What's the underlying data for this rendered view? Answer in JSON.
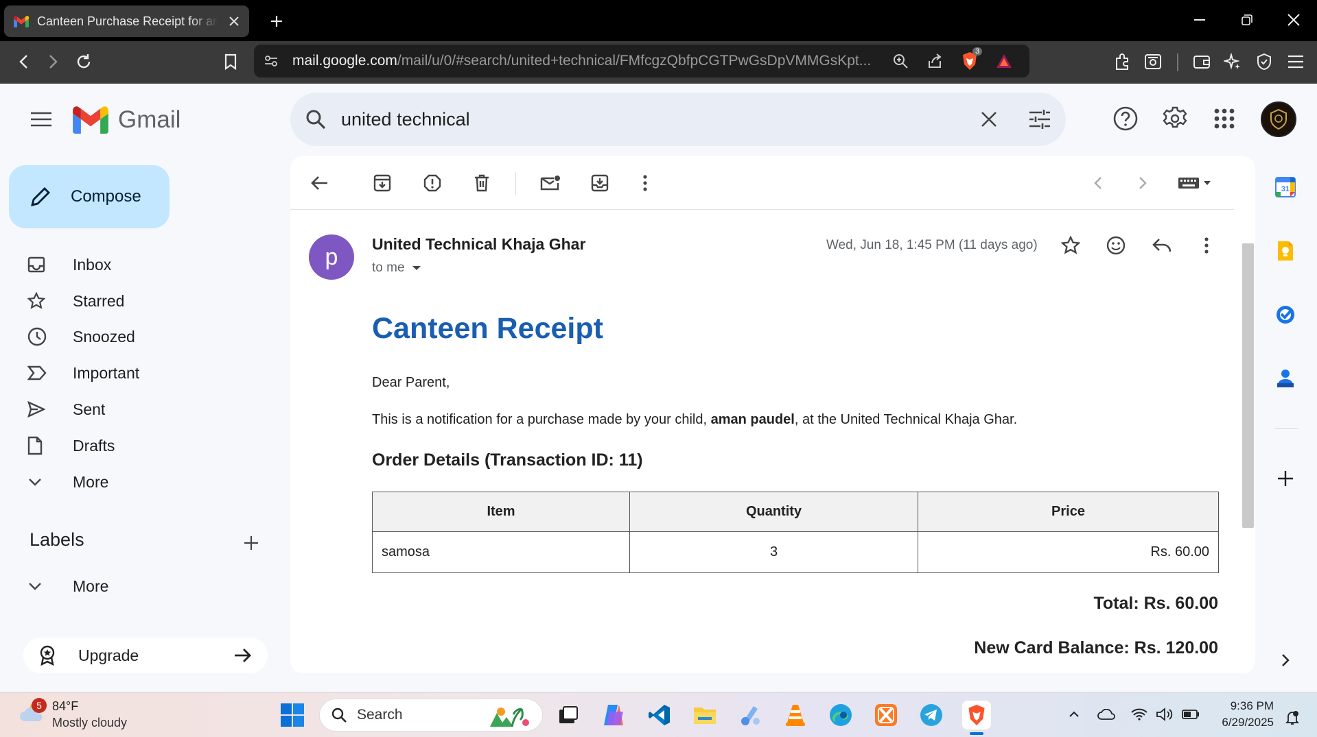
{
  "browser": {
    "tab_title": "Canteen Purchase Receipt for aman paudel",
    "url_host": "mail.google.com",
    "url_path": "/mail/u/0/#search/united+technical/FMfcgzQbfpCGTPwGsDpVMMGsKpt...",
    "brave_shield_count": "3"
  },
  "gmail": {
    "brand": "Gmail",
    "search_value": "united technical",
    "compose_label": "Compose",
    "nav": [
      {
        "label": "Inbox"
      },
      {
        "label": "Starred"
      },
      {
        "label": "Snoozed"
      },
      {
        "label": "Important"
      },
      {
        "label": "Sent"
      },
      {
        "label": "Drafts"
      },
      {
        "label": "More"
      }
    ],
    "labels_header": "Labels",
    "labels_more": "More",
    "upgrade_label": "Upgrade"
  },
  "message": {
    "sender_initial": "p",
    "sender_name": "United Technical Khaja Ghar",
    "to_line": "to me",
    "date": "Wed, Jun 18, 1:45 PM (11 days ago)",
    "title": "Canteen Receipt",
    "greeting": "Dear Parent,",
    "notice_pre": "This is a notification for a purchase made by your child, ",
    "child_name": "aman paudel",
    "notice_post": ", at the United Technical Khaja Ghar.",
    "order_header": "Order Details (Transaction ID: 11)",
    "table_headers": [
      "Item",
      "Quantity",
      "Price"
    ],
    "rows": [
      {
        "item": "samosa",
        "quantity": "3",
        "price": "Rs. 60.00"
      }
    ],
    "total": "Total: Rs. 60.00",
    "new_balance": "New Card Balance: Rs. 120.00"
  },
  "taskbar": {
    "weather_badge": "5",
    "weather_temp": "84°F",
    "weather_desc": "Mostly cloudy",
    "search_placeholder": "Search",
    "time": "9:36 PM",
    "date": "6/29/2025"
  },
  "colors": {
    "compose_bg": "#c2e7ff",
    "title_blue": "#1a5eb0",
    "sender_avatar": "#7e57c2"
  }
}
